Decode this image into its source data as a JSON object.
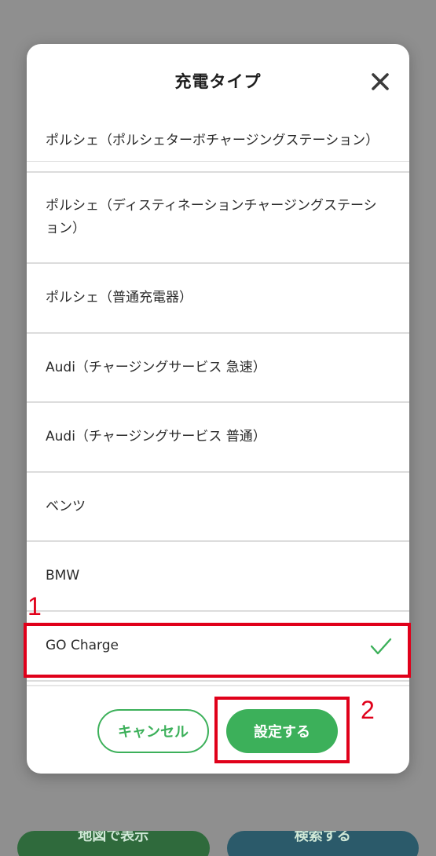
{
  "background": {
    "map_button_label": "地図で表示",
    "search_button_label": "検索する"
  },
  "modal": {
    "title": "充電タイプ",
    "options": [
      {
        "label": "ポルシェ（ポルシェターボチャージングステーション）",
        "selected": false
      },
      {
        "label": "ポルシェ（ディスティネーションチャージングステーション）",
        "selected": false
      },
      {
        "label": "ポルシェ（普通充電器）",
        "selected": false
      },
      {
        "label": "Audi（チャージングサービス 急速）",
        "selected": false
      },
      {
        "label": "Audi（チャージングサービス 普通）",
        "selected": false
      },
      {
        "label": "ベンツ",
        "selected": false
      },
      {
        "label": "BMW",
        "selected": false
      },
      {
        "label": "GO Charge",
        "selected": true
      }
    ],
    "cancel_label": "キャンセル",
    "confirm_label": "設定する"
  },
  "annotations": {
    "first": "1",
    "second": "2"
  },
  "colors": {
    "accent": "#3cb05a",
    "annotation": "#e0001a"
  }
}
